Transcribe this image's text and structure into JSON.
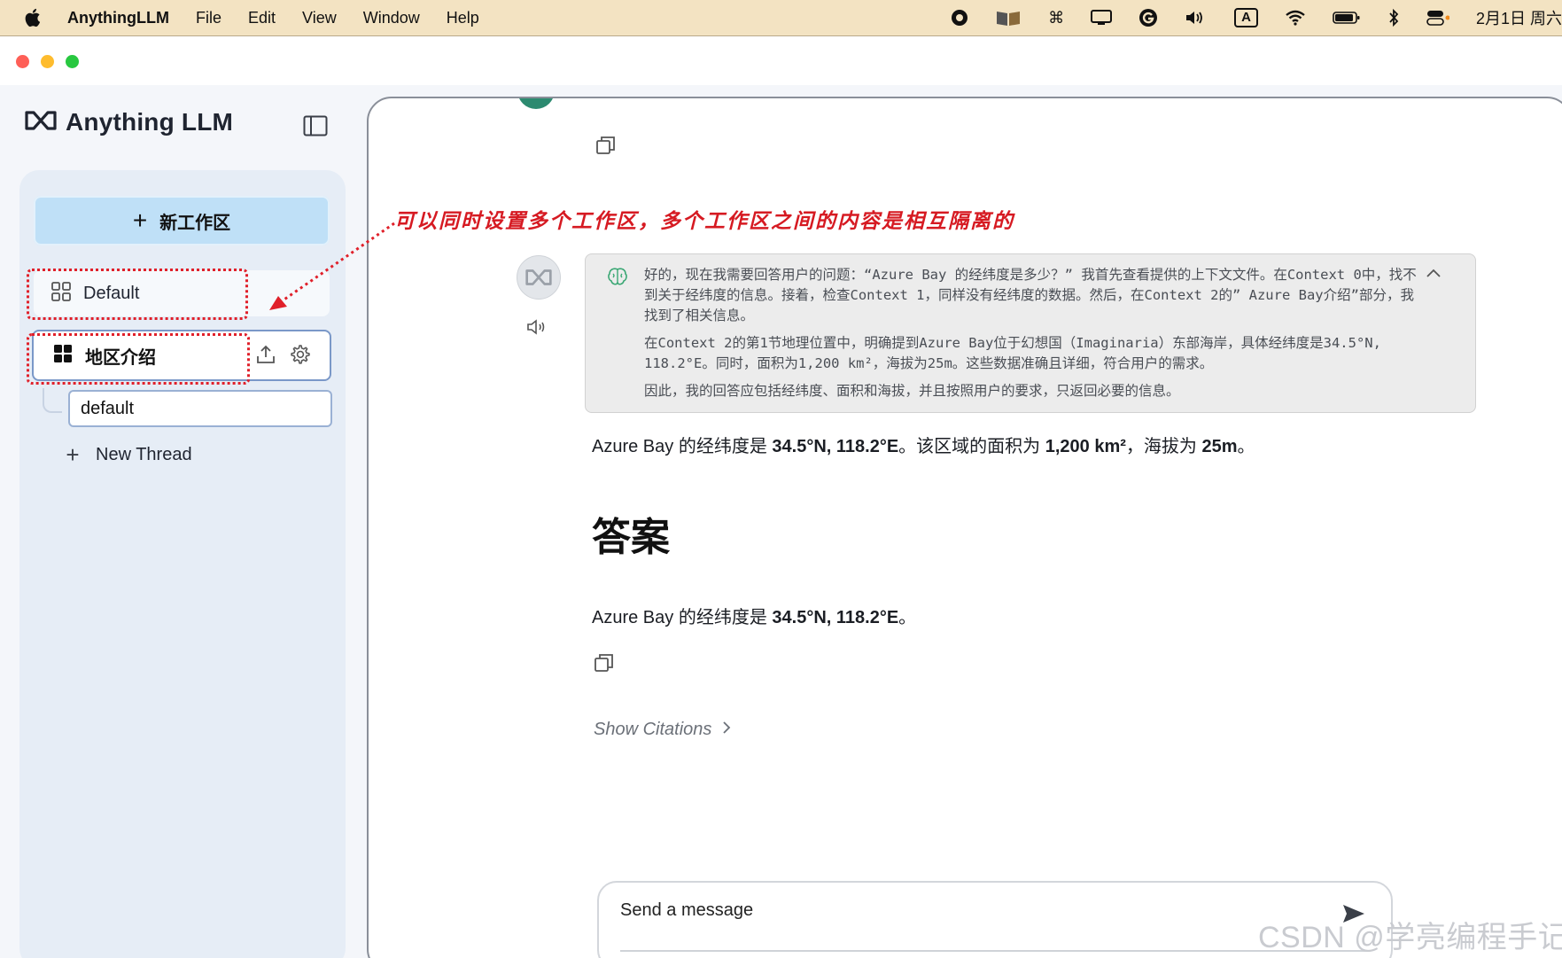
{
  "menubar": {
    "app_name": "AnythingLLM",
    "items": [
      "File",
      "Edit",
      "View",
      "Window",
      "Help"
    ],
    "tray_icons": [
      "record-icon",
      "book-icon",
      "command-icon",
      "display-icon",
      "grammarly-icon",
      "volume-icon",
      "input-source-icon",
      "wifi-icon",
      "battery-icon",
      "bluetooth-icon",
      "control-center-icon"
    ],
    "input_source_label": "A",
    "clock": "2月1日 周六"
  },
  "sidebar": {
    "brand": "Anything LLM",
    "new_workspace_label": "新工作区",
    "workspaces": [
      {
        "label": "Default",
        "active": false
      },
      {
        "label": "地区介绍",
        "active": true
      }
    ],
    "threads": [
      {
        "label": "default"
      }
    ],
    "new_thread_label": "New Thread"
  },
  "annotation": {
    "text": "可以同时设置多个工作区，多个工作区之间的内容是相互隔离的",
    "color": "#d61a22"
  },
  "chat": {
    "thinking": {
      "paragraphs": [
        "好的，现在我需要回答用户的问题：“Azure Bay 的经纬度是多少？” 我首先查看提供的上下文文件。在Context 0中，找不到关于经纬度的信息。接着，检查Context 1，同样没有经纬度的数据。然后，在Context 2的” Azure Bay介绍”部分，我找到了相关信息。",
        "在Context 2的第1节地理位置中，明确提到Azure Bay位于幻想国（Imaginaria）东部海岸，具体经纬度是34.5°N, 118.2°E。同时，面积为1,200 km²，海拔为25m。这些数据准确且详细，符合用户的需求。",
        "因此，我的回答应包括经纬度、面积和海拔，并且按照用户的要求，只返回必要的信息。"
      ]
    },
    "answer": {
      "prefix": "Azure Bay 的经纬度是 ",
      "coords": "34.5°N, 118.2°E",
      "mid": "。该区域的面积为 ",
      "area": "1,200 km²",
      "mid2": "，海拔为 ",
      "altitude": "25m",
      "suffix": "。"
    },
    "heading": "答案",
    "answer2": {
      "prefix": "Azure Bay 的经纬度是 ",
      "coords": "34.5°N, 118.2°E",
      "suffix": "。"
    },
    "show_citations_label": "Show Citations"
  },
  "composer": {
    "placeholder": "Send a message"
  },
  "watermark": "CSDN @学亮编程手记",
  "colors": {
    "menubar_bg": "#f3e3c2",
    "new_workspace_bg": "#bfe0f7",
    "annotation_red": "#d61a22",
    "sidebar_bg": "#e6edf6"
  }
}
